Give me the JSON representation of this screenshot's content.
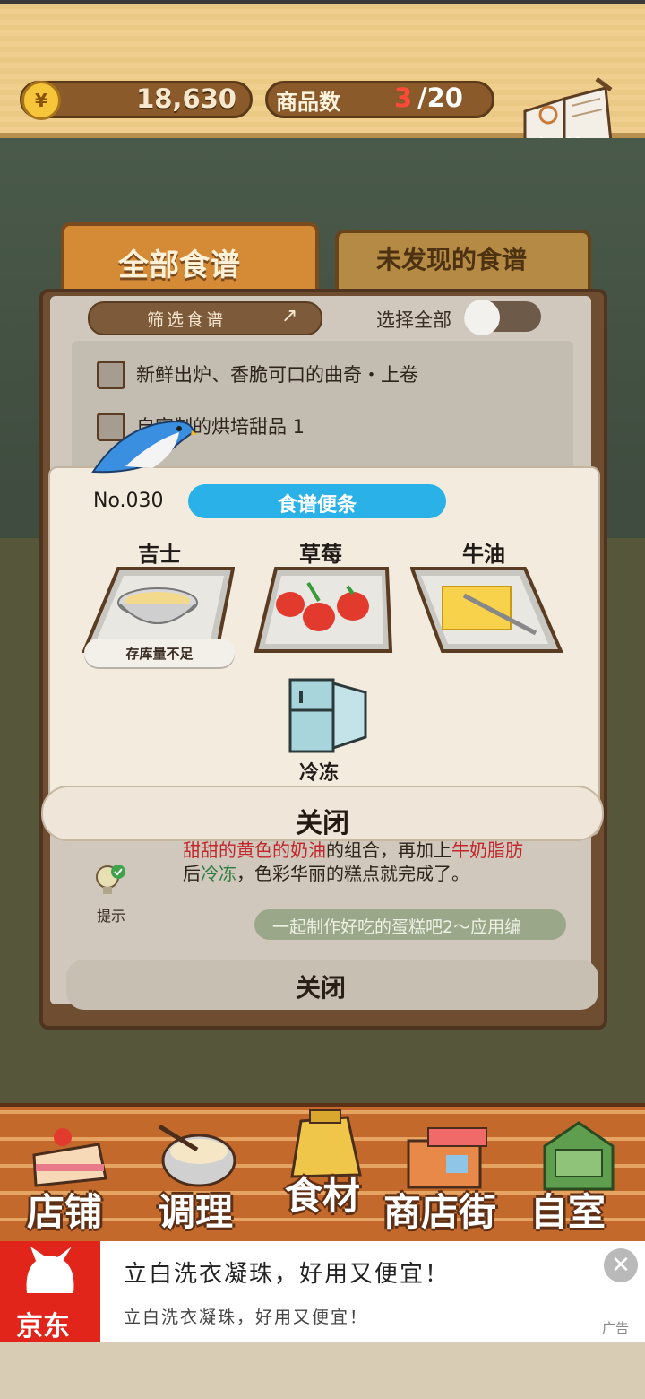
{
  "status": {
    "coin_symbol": "¥",
    "coins": "18,630",
    "goods_label": "商品数",
    "goods_count": "3",
    "goods_max": "/20"
  },
  "recipe_book": {
    "label": "食谱"
  },
  "tabs": [
    {
      "label": "全部食谱"
    },
    {
      "label": "未发现的食谱"
    }
  ],
  "filter": {
    "label": "筛选食谱",
    "select_all": "选择全部"
  },
  "list": [
    "新鲜出炉、香脆可口的曲奇・上卷",
    "自家制的烘培甜品 1"
  ],
  "description": {
    "line1_a": "甜甜的黄色的奶油",
    "line1_b": "的组合，再加上",
    "line1_c": "牛奶脂肪",
    "line2_a": "后",
    "line2_b": "冷冻",
    "line2_c": "，色彩华丽的糕点就完成了。"
  },
  "hint_label": "提示",
  "bottom_link": "一起制作好吃的蛋糕吧2～应用编",
  "back_close": "关闭",
  "modal": {
    "number": "No.030",
    "title": "食谱便条",
    "ingredients": [
      {
        "name": "吉士",
        "note": "存库量不足"
      },
      {
        "name": "草莓"
      },
      {
        "name": "牛油"
      }
    ],
    "method": "冷冻",
    "close": "关闭"
  },
  "nav": [
    {
      "label": "店铺"
    },
    {
      "label": "调理"
    },
    {
      "label": "食材"
    },
    {
      "label": "商店街"
    },
    {
      "label": "自室"
    }
  ],
  "ad": {
    "brand": "京东",
    "title": "立白洗衣凝珠，好用又便宜！",
    "subtitle": "立白洗衣凝珠，好用又便宜！",
    "tag": "广告"
  },
  "colors": {
    "accent_blue": "#29b1e8",
    "tab_active": "#d58b35",
    "ad_red": "#e1251b"
  }
}
